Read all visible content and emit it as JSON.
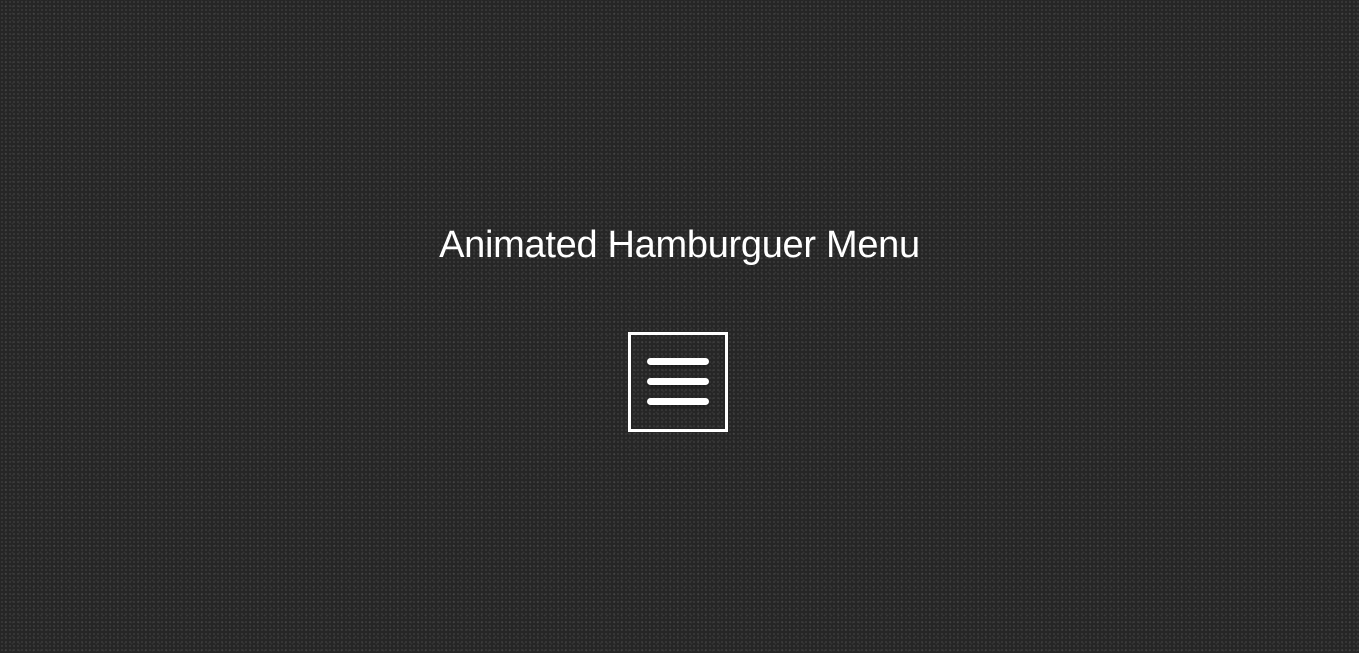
{
  "page": {
    "title": "Animated Hamburguer Menu",
    "background_color": "#262626",
    "text_color": "#ffffff"
  },
  "menu_button": {
    "icon": "hamburger-icon",
    "state": "closed",
    "bars": 3
  }
}
